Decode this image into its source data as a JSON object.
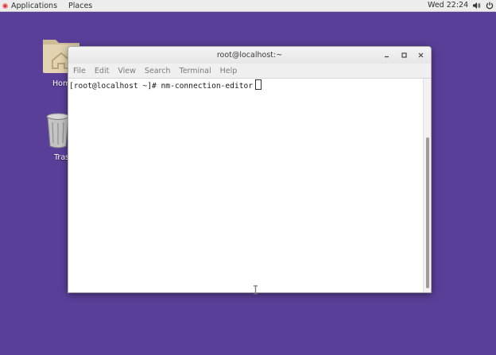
{
  "topbar": {
    "applications_label": "Applications",
    "places_label": "Places",
    "clock": "Wed 22:24"
  },
  "desktop": {
    "icons": [
      {
        "label": "Home",
        "icon": "folder-home-icon"
      },
      {
        "label": "Trash",
        "icon": "trash-icon"
      }
    ]
  },
  "terminal": {
    "title": "root@localhost:~",
    "menu": [
      "File",
      "Edit",
      "View",
      "Search",
      "Terminal",
      "Help"
    ],
    "prompt": "[root@localhost ~]# ",
    "command": "nm-connection-editor"
  },
  "colors": {
    "desktop_bg": "#5a3f99",
    "topbar_bg": "#ededed",
    "window_bg": "#ffffff"
  }
}
